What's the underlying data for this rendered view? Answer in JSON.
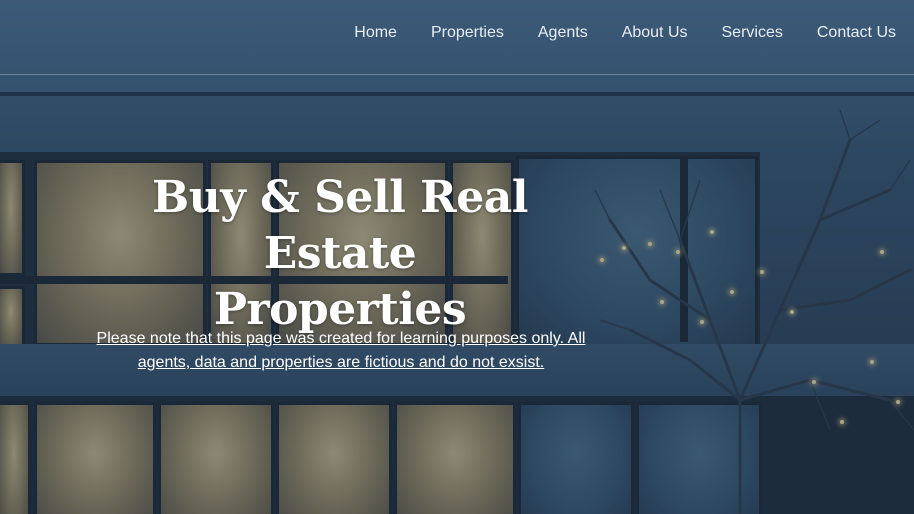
{
  "nav": {
    "items": [
      {
        "label": "Home"
      },
      {
        "label": "Properties"
      },
      {
        "label": "Agents"
      },
      {
        "label": "About Us"
      },
      {
        "label": "Services"
      },
      {
        "label": "Contact Us"
      }
    ]
  },
  "hero": {
    "title_line1": "Buy & Sell Real Estate",
    "title_line2": "Properties",
    "disclaimer": "Please note that this page was created for learning purposes only. All agents, data and properties are fictious and do not exsist."
  },
  "colors": {
    "overlay": "#223a52",
    "text": "#ffffff",
    "nav_text": "#e8edf2"
  }
}
